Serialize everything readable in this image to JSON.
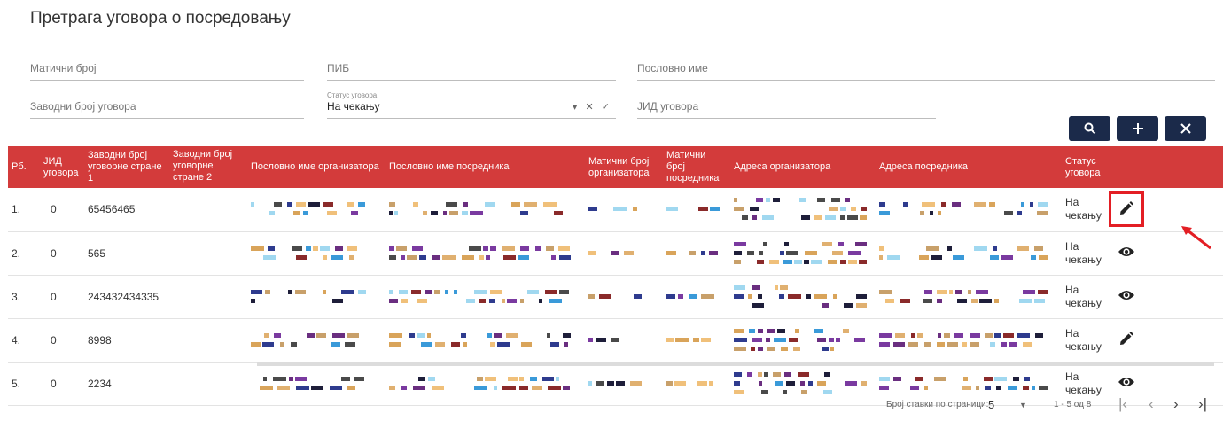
{
  "page": {
    "title": "Претрага уговора о посредовању"
  },
  "filters": {
    "maticni_broj": {
      "placeholder": "Матични број"
    },
    "pib": {
      "placeholder": "ПИБ"
    },
    "poslovno_ime": {
      "placeholder": "Пословно име"
    },
    "zavodni_broj": {
      "placeholder": "Заводни број уговора"
    },
    "status": {
      "label": "Статус уговора",
      "value": "На чекању",
      "controls": "▾ ✕ ✓"
    },
    "jid": {
      "placeholder": "ЈИД уговора"
    }
  },
  "toolbar": {
    "search_icon": "search-icon",
    "add_icon": "plus-icon",
    "clear_icon": "close-icon"
  },
  "table": {
    "headers": [
      "Рб.",
      "ЈИД уговора",
      "Заводни број уговорне стране 1",
      "Заводни број уговорне стране 2",
      "Пословно име организатора",
      "Пословно име посредника",
      "Матични број организатора",
      "Матични број посредника",
      "Адреса организатора",
      "Адреса посредника",
      "Статус уговора",
      ""
    ],
    "rows": [
      {
        "rb": "1.",
        "jid": "0",
        "zb1": "65456465",
        "status": "На чекању",
        "action_icon": "edit-icon"
      },
      {
        "rb": "2.",
        "jid": "0",
        "zb1": "565",
        "status": "На чекању",
        "action_icon": "eye-icon"
      },
      {
        "rb": "3.",
        "jid": "0",
        "zb1": "243432434335",
        "status": "На чекању",
        "action_icon": "eye-icon"
      },
      {
        "rb": "4.",
        "jid": "0",
        "zb1": "8998",
        "status": "На чекању",
        "action_icon": "edit-icon"
      },
      {
        "rb": "5.",
        "jid": "0",
        "zb1": "2234",
        "status": "На чекању",
        "action_icon": "eye-icon"
      }
    ]
  },
  "pager": {
    "items_label": "Број ставки по страници:",
    "page_size": "5",
    "range": "1 - 5 од 8"
  },
  "colors": {
    "header_bg": "#d33b3b",
    "button_bg": "#1b2a4a",
    "highlight": "#e31e24"
  }
}
